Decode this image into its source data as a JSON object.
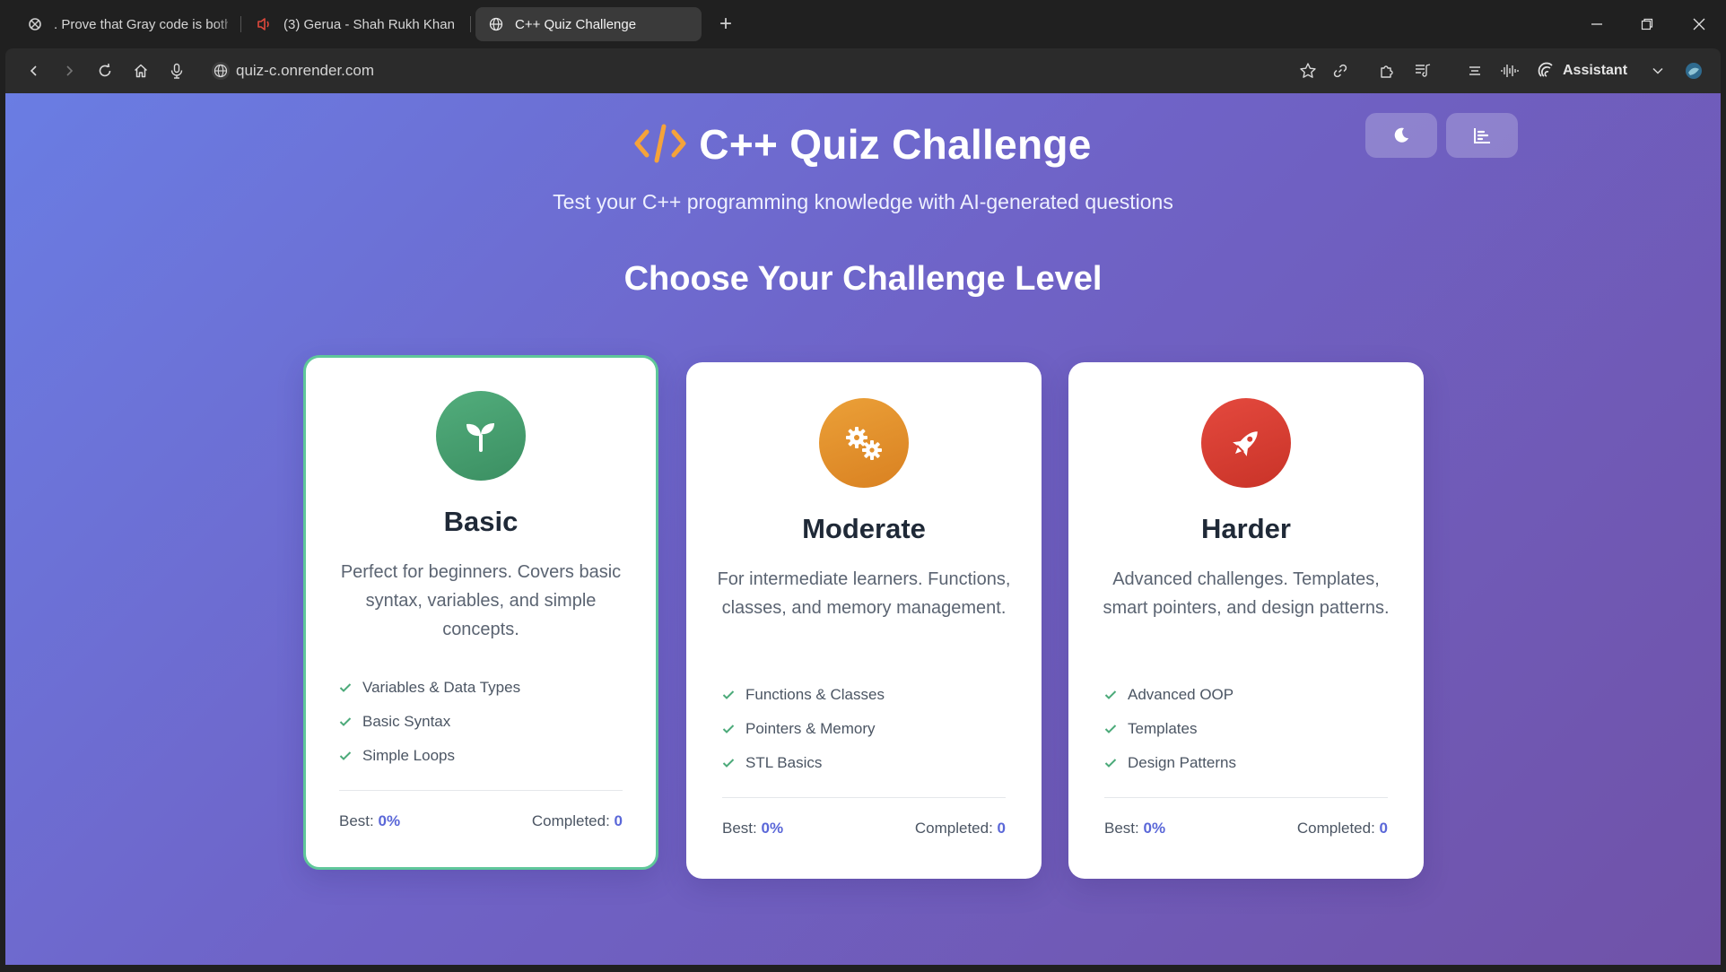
{
  "browser": {
    "tabs": [
      {
        "title": ". Prove that Gray code is both",
        "icon": "site-favicon"
      },
      {
        "title": "(3) Gerua - Shah Rukh Khan |",
        "icon": "speaker-muted-icon"
      },
      {
        "title": "C++ Quiz Challenge",
        "icon": "globe-icon",
        "active": true
      }
    ],
    "url": "quiz-c.onrender.com",
    "assistant_label": "Assistant"
  },
  "page": {
    "title": "C++ Quiz Challenge",
    "subtitle": "Test your C++ programming knowledge with AI-generated questions",
    "section_title": "Choose Your Challenge Level",
    "accent_color": "#5a67d8",
    "levels": [
      {
        "name": "Basic",
        "icon": "seedling-icon",
        "color": "#48a072",
        "description": "Perfect for beginners. Covers basic syntax, variables, and simple concepts.",
        "features": [
          "Variables & Data Types",
          "Basic Syntax",
          "Simple Loops"
        ],
        "best_label": "Best:",
        "best_value": "0%",
        "completed_label": "Completed:",
        "completed_value": "0",
        "selected": true
      },
      {
        "name": "Moderate",
        "icon": "gears-icon",
        "color": "#e3912c",
        "description": "For intermediate learners. Functions, classes, and memory management.",
        "features": [
          "Functions & Classes",
          "Pointers & Memory",
          "STL Basics"
        ],
        "best_label": "Best:",
        "best_value": "0%",
        "completed_label": "Completed:",
        "completed_value": "0"
      },
      {
        "name": "Harder",
        "icon": "rocket-icon",
        "color": "#d63d32",
        "description": "Advanced challenges. Templates, smart pointers, and design patterns.",
        "features": [
          "Advanced OOP",
          "Templates",
          "Design Patterns"
        ],
        "best_label": "Best:",
        "best_value": "0%",
        "completed_label": "Completed:",
        "completed_value": "0"
      }
    ]
  }
}
